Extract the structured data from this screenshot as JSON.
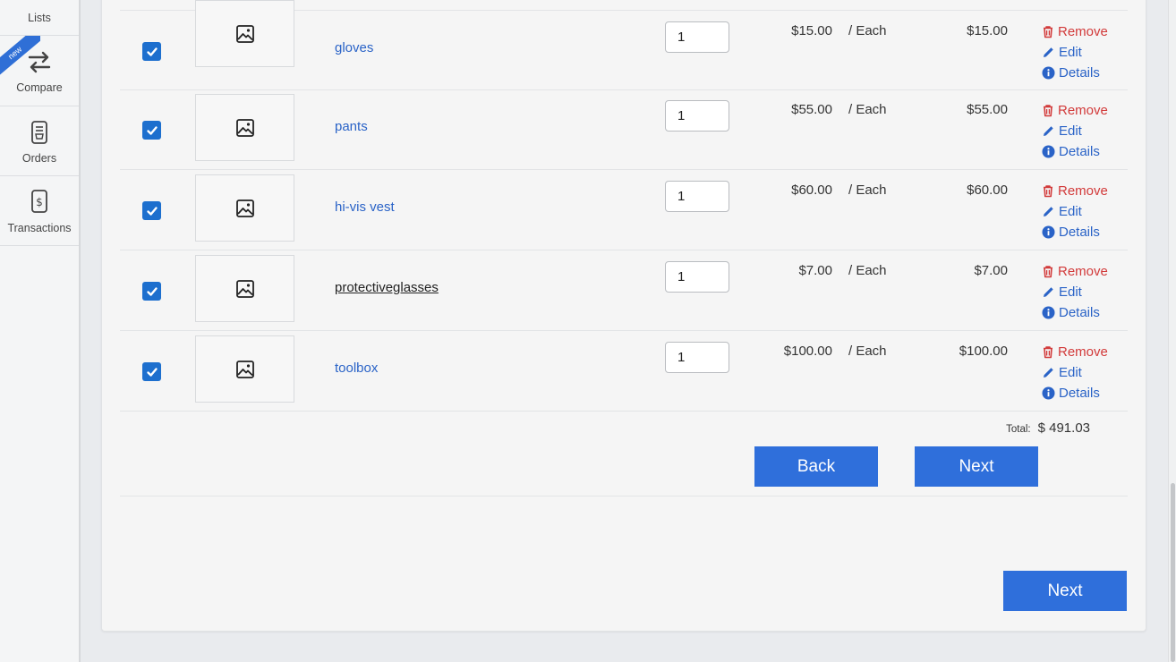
{
  "sidebar": {
    "items": [
      {
        "label": "Lists",
        "icon": "lists-icon"
      },
      {
        "label": "Compare",
        "icon": "compare-arrows-icon",
        "badge": "new"
      },
      {
        "label": "Orders",
        "icon": "orders-icon"
      },
      {
        "label": "Transactions",
        "icon": "transactions-icon"
      }
    ]
  },
  "cart": {
    "items": [
      {
        "name": "gloves",
        "qty": "1",
        "price": "$15.00",
        "unit": "/ Each",
        "total": "$15.00",
        "checked": true
      },
      {
        "name": "pants",
        "qty": "1",
        "price": "$55.00",
        "unit": "/ Each",
        "total": "$55.00",
        "checked": true
      },
      {
        "name": "hi-vis vest",
        "qty": "1",
        "price": "$60.00",
        "unit": "/ Each",
        "total": "$60.00",
        "checked": true
      },
      {
        "name": "protectiveglasses",
        "qty": "1",
        "price": "$7.00",
        "unit": "/ Each",
        "total": "$7.00",
        "checked": true
      },
      {
        "name": "toolbox",
        "qty": "1",
        "price": "$100.00",
        "unit": "/ Each",
        "total": "$100.00",
        "checked": true
      }
    ],
    "actions": {
      "remove": "Remove",
      "edit": "Edit",
      "details": "Details"
    },
    "total_label": "Total:",
    "total_value": "$ 491.03"
  },
  "buttons": {
    "back": "Back",
    "next": "Next",
    "next_bottom": "Next"
  },
  "colors": {
    "accent": "#2f6fdb",
    "link": "#2a63c7",
    "remove": "#d23a3a",
    "checkbox": "#1d6fce"
  }
}
